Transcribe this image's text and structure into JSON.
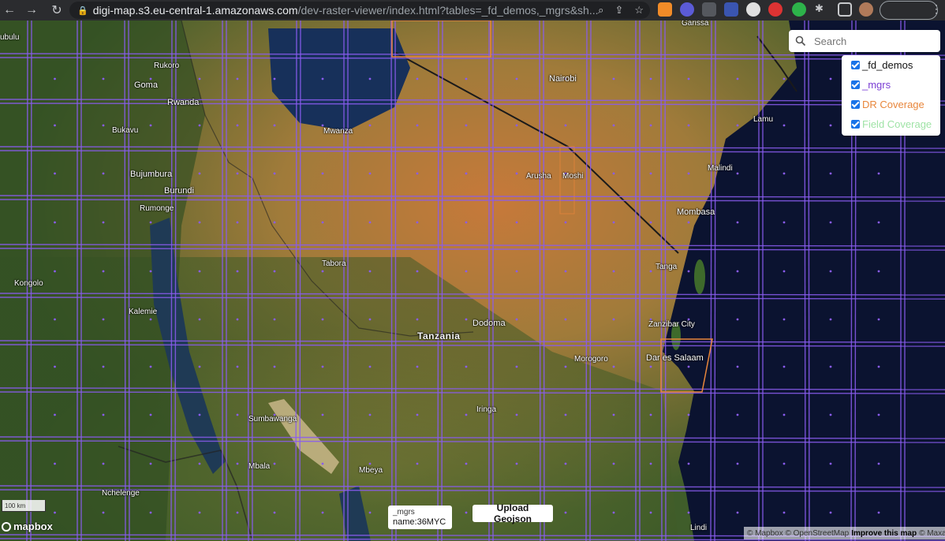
{
  "browser": {
    "url_host": "digi-map.s3.eu-central-1.amazonaws.com",
    "url_rest": "/dev-raster-viewer/index.html?tables=_fd_demos,_mgrs&sh...",
    "nav_icons": [
      "back-arrow-icon",
      "forward-arrow-icon",
      "reload-icon"
    ],
    "address_icons": [
      "zoom-icon",
      "share-icon",
      "star-icon"
    ]
  },
  "search": {
    "placeholder": "Search"
  },
  "layers": [
    {
      "label": "_fd_demos",
      "color": "#111111",
      "checked": true
    },
    {
      "label": "_mgrs",
      "color": "#7b3fd4",
      "checked": true
    },
    {
      "label": "DR Coverage",
      "color": "#e8863b",
      "checked": true
    },
    {
      "label": "Field Coverage",
      "color": "#9fe3a6",
      "checked": true
    }
  ],
  "places": {
    "ubulu": "ubulu",
    "rukoro": "Rukoro",
    "goma": "Goma",
    "rwanda": "Rwanda",
    "nairobi": "Nairobi",
    "garissa": "Garissa",
    "bukavu": "Bukavu",
    "mwanza": "Mwanza",
    "lamu": "Lamu",
    "bujumbura": "Bujumbura",
    "burundi": "Burundi",
    "arusha": "Arusha",
    "moshi": "Moshi",
    "malindi": "Malindi",
    "rumonge": "Rumonge",
    "mombasa": "Mombasa",
    "tabora": "Tabora",
    "tanga": "Tanga",
    "kongolo": "Kongolo",
    "kalemie": "Kalemie",
    "zanzibar": "Zanzibar City",
    "dodoma": "Dodoma",
    "tanzania": "Tanzania",
    "morogoro": "Morogoro",
    "dar": "Dar es Salaam",
    "iringa": "Iringa",
    "sumbawanga": "Sumbawanga",
    "mbala": "Mbala",
    "mbeya": "Mbeya",
    "nchelenge": "Nchelenge",
    "lindi": "Lindi"
  },
  "scale": {
    "label": "100 km"
  },
  "logo": "mapbox",
  "popup": {
    "layer": "_mgrs",
    "text": "name:36MYC"
  },
  "upload": {
    "label": "Upload Geojson"
  },
  "attribution": {
    "a": "© Mapbox © OpenStreetMap",
    "b": "Improve this map",
    "c": "© Maxar"
  },
  "colors": {
    "grid": "#8a5cf0",
    "dr": "#e8863b",
    "ocean": "#0b1330"
  }
}
